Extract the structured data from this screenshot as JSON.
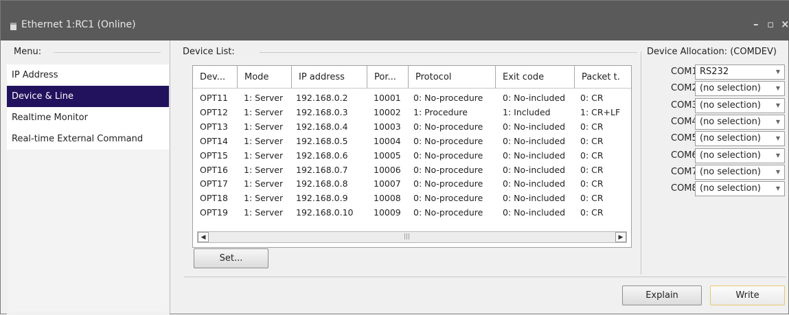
{
  "window": {
    "title": "Ethernet 1:RC1 (Online)",
    "minimize": "–",
    "maximize": "▫",
    "close": "×"
  },
  "menu": {
    "header": "Menu:",
    "items": [
      "IP Address",
      "Device & Line",
      "Realtime Monitor",
      "Real-time External Command"
    ],
    "selected_index": 1
  },
  "device_list": {
    "header": "Device List:",
    "columns": [
      "Dev...",
      "Mode",
      "IP address",
      "Por...",
      "Protocol",
      "Exit code",
      "Packet t."
    ],
    "rows": [
      [
        "OPT11",
        "1: Server",
        "192.168.0.2",
        "10001",
        "0: No-procedure",
        "0: No-included",
        "0: CR"
      ],
      [
        "OPT12",
        "1: Server",
        "192.168.0.3",
        "10002",
        "1: Procedure",
        "1: Included",
        "1: CR+LF"
      ],
      [
        "OPT13",
        "1: Server",
        "192.168.0.4",
        "10003",
        "0: No-procedure",
        "0: No-included",
        "0: CR"
      ],
      [
        "OPT14",
        "1: Server",
        "192.168.0.5",
        "10004",
        "0: No-procedure",
        "0: No-included",
        "0: CR"
      ],
      [
        "OPT15",
        "1: Server",
        "192.168.0.6",
        "10005",
        "0: No-procedure",
        "0: No-included",
        "0: CR"
      ],
      [
        "OPT16",
        "1: Server",
        "192.168.0.7",
        "10006",
        "0: No-procedure",
        "0: No-included",
        "0: CR"
      ],
      [
        "OPT17",
        "1: Server",
        "192.168.0.8",
        "10007",
        "0: No-procedure",
        "0: No-included",
        "0: CR"
      ],
      [
        "OPT18",
        "1: Server",
        "192.168.0.9",
        "10008",
        "0: No-procedure",
        "0: No-included",
        "0: CR"
      ],
      [
        "OPT19",
        "1: Server",
        "192.168.0.10",
        "10009",
        "0: No-procedure",
        "0: No-included",
        "0: CR"
      ]
    ],
    "set_button": "Set..."
  },
  "allocation": {
    "header": "Device Allocation: (COMDEV)",
    "ports": [
      {
        "label": "COM1:",
        "value": "RS232"
      },
      {
        "label": "COM2:",
        "value": "(no selection)"
      },
      {
        "label": "COM3:",
        "value": "(no selection)"
      },
      {
        "label": "COM4:",
        "value": "(no selection)"
      },
      {
        "label": "COM5:",
        "value": "(no selection)"
      },
      {
        "label": "COM6:",
        "value": "(no selection)"
      },
      {
        "label": "COM7:",
        "value": "(no selection)"
      },
      {
        "label": "COM8:",
        "value": "(no selection)"
      }
    ]
  },
  "buttons": {
    "explain": "Explain",
    "write": "Write"
  },
  "icons": {
    "app": "document-icon",
    "dropdown": "chevron-down-icon",
    "scroll_left": "arrow-left-icon",
    "scroll_right": "arrow-right-icon"
  },
  "colors": {
    "selection": "#22125e",
    "titlebar": "#5a5a5a",
    "default_button_border": "#e7c86c"
  }
}
